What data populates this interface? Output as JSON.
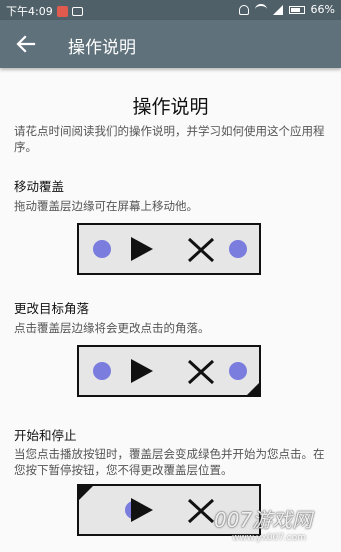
{
  "status_bar": {
    "time": "下午4:09",
    "battery": "66%"
  },
  "app_bar": {
    "title": "操作说明"
  },
  "main": {
    "title": "操作说明",
    "intro": "请花点时间阅读我们的操作说明，并学习如何使用这个应用程序。",
    "sections": [
      {
        "heading": "移动覆盖",
        "body": "拖动覆盖层边缘可在屏幕上移动他。"
      },
      {
        "heading": "更改目标角落",
        "body": "点击覆盖层边缘将会更改点击的角落。"
      },
      {
        "heading": "开始和停止",
        "body": "当您点击播放按钮时，覆盖层会变成绿色并开始为您点击。在您按下暂停按钮，您不得更改覆盖层位置。"
      }
    ]
  },
  "watermark": {
    "text": "007游戏网",
    "url": "www.yx007.com"
  },
  "colors": {
    "status_bar": "#506069",
    "app_bar": "#5f717b",
    "dot": "#7a7cde"
  }
}
